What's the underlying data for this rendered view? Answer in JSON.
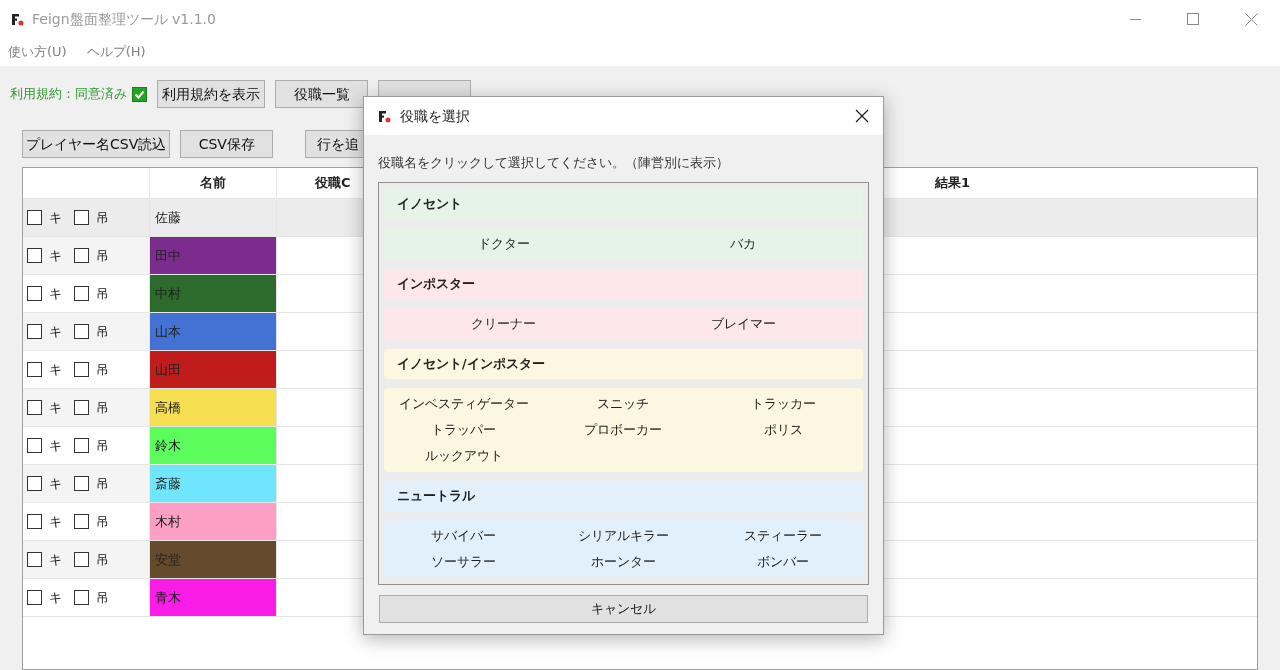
{
  "window": {
    "title": "Feign盤面整理ツール v1.1.0"
  },
  "menu": [
    "使い方(U)",
    "ヘルプ(H)"
  ],
  "terms": {
    "label": "利用規約：同意済み",
    "checked": true
  },
  "toolbar_top": [
    "利用規約を表示",
    "役職一覧"
  ],
  "toolbar_bottom": [
    "プレイヤー名CSV読込",
    "CSV保存",
    "行を追"
  ],
  "table": {
    "columns": [
      "名前",
      "役職C",
      "結果1"
    ],
    "rows": [
      {
        "selected": true,
        "checks": [
          {
            "label": "キ",
            "checked": false
          },
          {
            "label": "吊",
            "checked": false
          }
        ],
        "name": "佐藤"
      },
      {
        "selected": false,
        "checks": [
          {
            "label": "キ",
            "checked": false
          },
          {
            "label": "吊",
            "checked": false
          }
        ],
        "name": "田中",
        "color": "#7b2d8e"
      },
      {
        "selected": false,
        "checks": [
          {
            "label": "キ",
            "checked": false
          },
          {
            "label": "吊",
            "checked": false
          }
        ],
        "name": "中村",
        "color": "#2c6b2c"
      },
      {
        "selected": false,
        "checks": [
          {
            "label": "キ",
            "checked": false
          },
          {
            "label": "吊",
            "checked": false
          }
        ],
        "name": "山本",
        "color": "#4472d4"
      },
      {
        "selected": false,
        "checks": [
          {
            "label": "キ",
            "checked": false
          },
          {
            "label": "吊",
            "checked": false
          }
        ],
        "name": "山田",
        "color": "#c01c1c"
      },
      {
        "selected": false,
        "checks": [
          {
            "label": "キ",
            "checked": false
          },
          {
            "label": "吊",
            "checked": false
          }
        ],
        "name": "高橋",
        "color": "#f5de50"
      },
      {
        "selected": false,
        "checks": [
          {
            "label": "キ",
            "checked": false
          },
          {
            "label": "吊",
            "checked": false
          }
        ],
        "name": "鈴木",
        "color": "#5dfc5d"
      },
      {
        "selected": false,
        "checks": [
          {
            "label": "キ",
            "checked": false
          },
          {
            "label": "吊",
            "checked": false
          }
        ],
        "name": "斎藤",
        "color": "#6fe6fb"
      },
      {
        "selected": false,
        "checks": [
          {
            "label": "キ",
            "checked": false
          },
          {
            "label": "吊",
            "checked": false
          }
        ],
        "name": "木村",
        "color": "#fd9ec5"
      },
      {
        "selected": false,
        "checks": [
          {
            "label": "キ",
            "checked": false
          },
          {
            "label": "吊",
            "checked": false
          }
        ],
        "name": "安堂",
        "color": "#664a2c"
      },
      {
        "selected": false,
        "checks": [
          {
            "label": "キ",
            "checked": false
          },
          {
            "label": "吊",
            "checked": false
          }
        ],
        "name": "青木",
        "color": "#fc1ce8"
      }
    ]
  },
  "dialog": {
    "title": "役職を選択",
    "instruction": "役職名をクリックして選択してください。（陣営別に表示）",
    "sections": [
      {
        "title": "イノセント",
        "color": "#e6f4e7",
        "roles": [
          "ドクター",
          "バカ"
        ]
      },
      {
        "title": "インポスター",
        "color": "#fde7ea",
        "roles": [
          "クリーナー",
          "ブレイマー"
        ]
      },
      {
        "title": "イノセント/インポスター",
        "color": "#fdf6e1",
        "roles": [
          "インベスティゲーター",
          "スニッチ",
          "トラッカー",
          "トラッパー",
          "プロボーカー",
          "ポリス",
          "ルックアウト"
        ]
      },
      {
        "title": "ニュートラル",
        "color": "#e2f0fb",
        "roles": [
          "サバイバー",
          "シリアルキラー",
          "スティーラー",
          "ソーサラー",
          "ホーンター",
          "ボンバー"
        ]
      }
    ],
    "cancel": "キャンセル"
  }
}
